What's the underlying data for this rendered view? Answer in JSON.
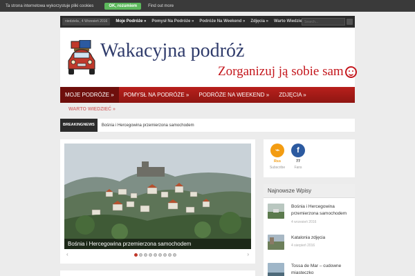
{
  "cookie": {
    "text": "Ta strona internetowa wykorzystuje pliki cookies",
    "ok_label": "OK, rozumiem",
    "find_label": "Find out more"
  },
  "topbar": {
    "date": "niedziela , 4 Wrzesień 2016",
    "menu": [
      "Moje Podróże »",
      "Pomysł Na Podróże »",
      "Podróże Na Weekend »",
      "Zdjęcia »",
      "Warto Wiedzieć »"
    ],
    "search_placeholder": "Search..."
  },
  "header": {
    "title": "Wakacyjna podróż",
    "tagline": "Zorganizuj ją sobie sam"
  },
  "mainnav": [
    "MOJE PODRÓŻE »",
    "POMYSŁ NA PODRÓŻE »",
    "PODRÓŻE NA WEEKEND »",
    "ZDJĘCIA »"
  ],
  "subnav": "WARTO WIEDZIEĆ »",
  "breaking": {
    "label": "BREAKINGNEWS",
    "text": "Bośnia i Hercegowina przemierzona samochodem"
  },
  "slider": {
    "caption": "Bośnia i Hercegowina przemierzona samochodem",
    "prev": "‹",
    "next": "›",
    "dot_count": 9,
    "active_dot": 0
  },
  "social": {
    "rss": {
      "glyph": "⌁",
      "label": "Rss",
      "sub": "Subscribe",
      "color": "#f39c12"
    },
    "fb": {
      "glyph": "f",
      "count": "77",
      "sub": "Fans",
      "color": "#2c5aa0"
    }
  },
  "sidebar": {
    "title": "Najnowsze Wpisy",
    "posts": [
      {
        "title": "Bośnia i Hercegowina przemierzona samochodem",
        "date": "4 wrzesień 2016"
      },
      {
        "title": "Katalonia zdjęcia",
        "date": "4 sierpień 2016"
      },
      {
        "title": "Tossa de Mar – cudowne miasteczko",
        "date": ""
      }
    ]
  },
  "colors": {
    "accent": "#b8201c",
    "title": "#2f3b6b",
    "tagline": "#c4161c"
  }
}
